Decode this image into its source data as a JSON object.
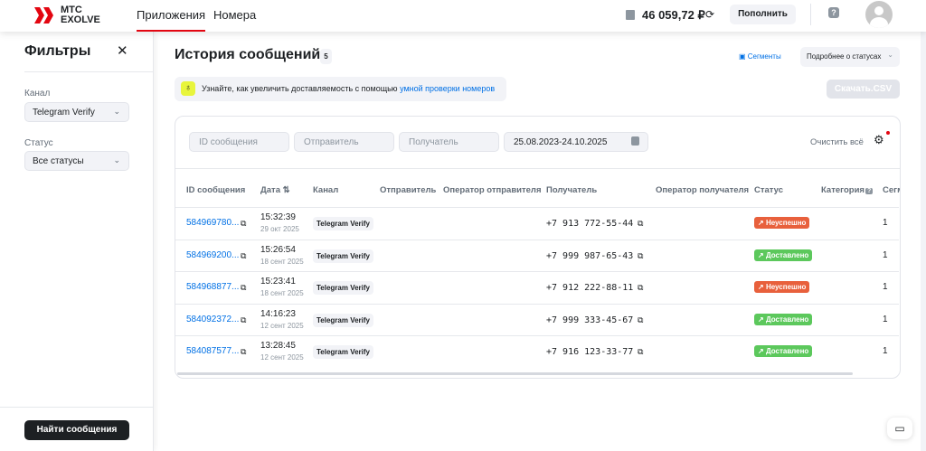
{
  "header": {
    "logo_line1": "МТС",
    "logo_line2": "EXOLVE",
    "nav": [
      "Приложения",
      "Номера"
    ],
    "balance": "46 059,72 ₽",
    "topup": "Пополнить"
  },
  "sidebar": {
    "title": "Фильтры",
    "channel_label": "Канал",
    "channel_value": "Telegram Verify",
    "status_label": "Статус",
    "status_value": "Все статусы",
    "find_button": "Найти сообщения"
  },
  "main": {
    "title": "История сообщений",
    "count": "5",
    "segments": "Сегменты",
    "status_details": "Подробнее о статусах",
    "tip_text": "Узнайте, как увеличить доставляемость с помощью ",
    "tip_link": "умной проверки номеров",
    "download": "Скачать.CSV"
  },
  "filters": {
    "id_placeholder": "ID сообщения",
    "sender_placeholder": "Отправитель",
    "recipient_placeholder": "Получатель",
    "date_range": "25.08.2023-24.10.2025",
    "clear_all": "Очистить всё"
  },
  "table": {
    "headers": [
      "ID сообщения",
      "Дата",
      "Канал",
      "Отправитель",
      "Оператор отправителя",
      "Получатель",
      "Оператор получателя",
      "Статус",
      "Категория",
      "Сегм"
    ],
    "rows": [
      {
        "id": "584969780...",
        "time": "15:32:39",
        "date": "29 окт 2025",
        "channel": "Telegram Verify",
        "recipient": "+7 913 772-55-44",
        "status": "Неуспешно",
        "segments": "1"
      },
      {
        "id": "584969200...",
        "time": "15:26:54",
        "date": "18 сент 2025",
        "channel": "Telegram Verify",
        "recipient": "+7 999 987-65-43",
        "status": "Доставлено",
        "segments": "1"
      },
      {
        "id": "584968877...",
        "time": "15:23:41",
        "date": "18 сент 2025",
        "channel": "Telegram Verify",
        "recipient": "+7 912 222-88-11",
        "status": "Неуспешно",
        "segments": "1"
      },
      {
        "id": "584092372...",
        "time": "14:16:23",
        "date": "12 сент 2025",
        "channel": "Telegram Verify",
        "recipient": "+7 999 333-45-67",
        "status": "Доставлено",
        "segments": "1"
      },
      {
        "id": "584087577...",
        "time": "13:28:45",
        "date": "12 сент 2025",
        "channel": "Telegram Verify",
        "recipient": "+7 916 123-33-77",
        "status": "Доставлено",
        "segments": "1"
      }
    ]
  },
  "colors": {
    "brand": "#e30611",
    "link": "#0070e5",
    "failed": "#e8603c",
    "delivered": "#5cc85c"
  }
}
